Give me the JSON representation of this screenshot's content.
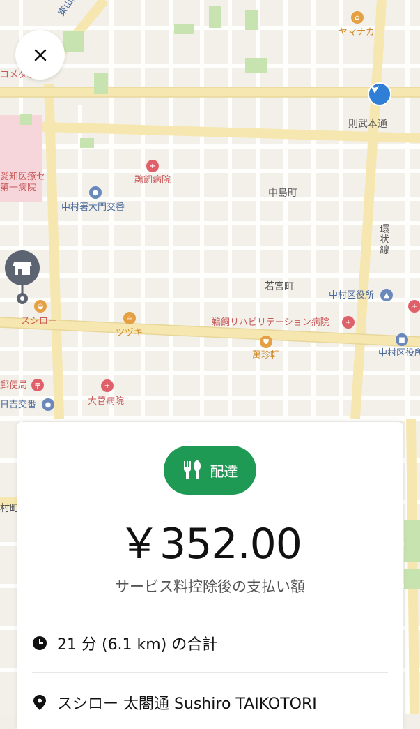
{
  "map": {
    "labels": {
      "higashiyama": "東山線",
      "yamanaka": "ヤマナカ",
      "komeda": "コメダ珈琲",
      "norutakehon": "則武本通",
      "aichi_line1": "愛知医療セ",
      "aichi_line2": "第一病院",
      "ukai": "鵜飼病院",
      "nakamura_police": "中村署大門交番",
      "nakajima": "中島町",
      "kanjo": "環状線",
      "wakamiya": "若宮町",
      "nakamura_ward1": "中村区役所",
      "sushiro": "スシロー",
      "tsuzuki": "ツヅキ",
      "ukai_rehab": "鵜飼リハビリテーション病院",
      "nakamura_ward2": "中村区役所",
      "manchin": "萬珍軒",
      "post": "郵便局",
      "ohsuga": "大菅病院",
      "hiyoshi": "日吉交番",
      "edge_left": "村町"
    },
    "icons": [
      "close-icon",
      "store-icon",
      "navigation-arrow-icon",
      "hospital-icon",
      "police-icon",
      "restaurant-icon",
      "cafe-icon",
      "post-office-icon",
      "shopping-icon",
      "government-icon",
      "station-icon"
    ]
  },
  "card": {
    "badge_label": "配達",
    "price": "￥352.00",
    "subtitle": "サービス料控除後の支払い額",
    "time_distance": "21 分 (6.1 km) の合計",
    "pickup": "スシロー 太閤通 Sushiro TAIKOTORI"
  },
  "colors": {
    "accent_green": "#1e9a55",
    "nav_blue": "#2f7fd6",
    "map_background": "#f3f0ea",
    "major_road": "#f6e7b0"
  }
}
